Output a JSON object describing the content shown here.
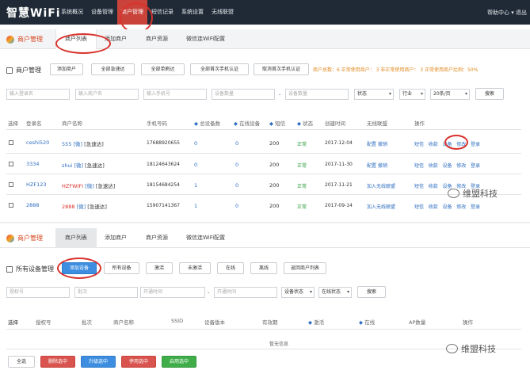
{
  "app": {
    "logo": "智慧WiFi",
    "help": "帮助中心 ▾ 退出"
  },
  "nav": [
    "系统概况",
    "设备管理",
    "商户管理",
    "短信记录",
    "系统设置",
    "无线联盟"
  ],
  "top": {
    "tabbar": {
      "title": "商户管理",
      "tabs": [
        "商户列表",
        "添加商户",
        "商户资源",
        "微信连WiFi配置"
      ]
    },
    "section_title": "商户管理",
    "buttons": [
      "添加商户",
      "全部急速达",
      "全部单刷达",
      "全部首次手机认证",
      "取消首次手机认证"
    ],
    "stats": "商户总数：6  正常使用商户：  3  非正常使用商户：  3  正常使用商户比例：50%",
    "filters": {
      "login_ph": "输入登录名",
      "merchant_ph": "输入商户名",
      "phone_ph": "输入手机号",
      "dev_ph": "设备数量",
      "dev_ph2": "设备数量",
      "dash": "-",
      "status": "状态",
      "industry": "行业",
      "per_page": "20条/页",
      "search": "搜索"
    },
    "headers": [
      "选择",
      "登录名",
      "商户名称",
      "手机号码",
      "总设备数",
      "在线设备",
      "短信",
      "状态",
      "创建时间",
      "无线联盟",
      "操作"
    ],
    "rows": [
      {
        "login": "ceshi520",
        "name_a": "555",
        "name_b": "[微]",
        "name_c": "[急速达]",
        "phone": "17688920655",
        "total": "0",
        "online": "0",
        "sms": "200",
        "status": "正常",
        "created": "2017-12-04",
        "union_a": "配置",
        "union_b": "撤销",
        "ops": [
          "短信",
          "收款",
          "设备",
          "修改",
          "登录"
        ]
      },
      {
        "login": "3334",
        "name_a": "shui",
        "name_b": "[微]",
        "name_c": "[急速达]",
        "phone": "18124643624",
        "total": "0",
        "online": "0",
        "sms": "200",
        "status": "正常",
        "created": "2017-11-30",
        "union_a": "配置",
        "union_b": "撤销",
        "ops": [
          "短信",
          "收款",
          "设备",
          "修改",
          "登录"
        ]
      },
      {
        "login": "HZF123",
        "name_a": "HZFWIFI",
        "name_b": "[微]",
        "name_c": "[急速达]",
        "phone": "18154684254",
        "total": "1",
        "online": "0",
        "sms": "200",
        "status": "正常",
        "created": "2017-11-21",
        "union_a": "加入无线联盟",
        "union_b": "",
        "ops": [
          "短信",
          "收款",
          "设备",
          "修改",
          "登录"
        ]
      },
      {
        "login": "2888",
        "name_a": "2888",
        "name_b": "[微]",
        "name_c": "[急速达]",
        "phone": "15907141367",
        "total": "1",
        "online": "0",
        "sms": "200",
        "status": "正常",
        "created": "2017-09-14",
        "union_a": "加入无线联盟",
        "union_b": "",
        "ops": [
          "短信",
          "收款",
          "设备",
          "修改",
          "登录"
        ]
      }
    ]
  },
  "bottom": {
    "tabbar": {
      "title": "商户管理",
      "tabs": [
        "商户列表",
        "添加商户",
        "商户资源",
        "微信连WiFi配置"
      ]
    },
    "section_title": "所有设备管理",
    "buttons": [
      "添加设备",
      "所有设备",
      "激活",
      "未激活",
      "在线",
      "离线",
      "返回商户列表"
    ],
    "filters": {
      "auth_ph": "授权号",
      "batch_ph": "批次",
      "start_ph": "开通时间",
      "dash": "-",
      "start_ph2": "开通时间",
      "dev_status": "设备状态",
      "online_status": "在线状态",
      "search": "搜索"
    },
    "headers": [
      "选择",
      "授权号",
      "批次",
      "商户名称",
      "SSID",
      "设备版本",
      "有效期",
      "激活",
      "在线",
      "AP数量",
      "操作"
    ],
    "empty": "暂无信息",
    "footer_buttons": [
      "全选",
      "删除选中",
      "升级选中",
      "停用选中",
      "启用选中"
    ]
  },
  "watermark": "维盟科技"
}
